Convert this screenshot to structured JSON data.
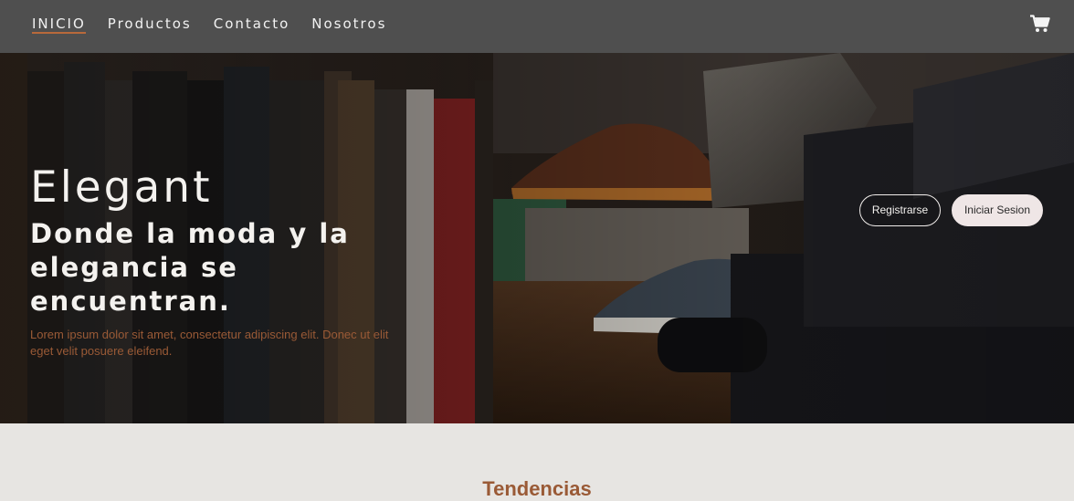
{
  "nav": {
    "links": [
      "INICIO",
      "Productos",
      "Contacto",
      "Nosotros"
    ],
    "active_index": 0,
    "cart_icon": "shopping-cart-icon"
  },
  "hero": {
    "brand": "Elegant",
    "tagline": "Donde la moda y la elegancia se encuentran.",
    "description": "Lorem ipsum dolor sit amet, consectetur adipiscing elit. Donec ut elit eget velit posuere eleifend.",
    "register_label": "Registrarse",
    "login_label": "Iniciar Sesion"
  },
  "section": {
    "title": "Tendencias"
  },
  "colors": {
    "nav_bg": "#4f4f4f",
    "accent": "#9a5a36",
    "page_bg": "#e7e5e2"
  }
}
